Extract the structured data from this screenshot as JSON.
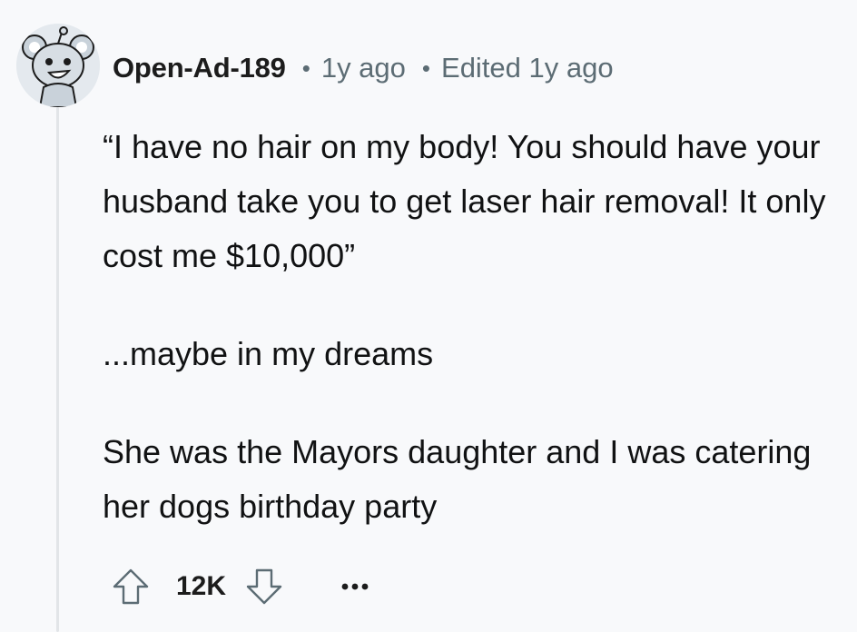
{
  "comment": {
    "author": "Open-Ad-189",
    "separator": "•",
    "age": "1y ago",
    "edited": "Edited 1y ago",
    "paragraphs": [
      "“I have no hair on my body! You should have your husband take you to get laser hair removal! It only cost me $10,000”",
      "...maybe in my dreams",
      "She was the Mayors daughter and I was catering her dogs birthday party"
    ]
  },
  "actions": {
    "score": "12K",
    "upvote_icon": "arrow-up-outline-icon",
    "downvote_icon": "arrow-down-outline-icon",
    "more_icon": "ellipsis-icon"
  },
  "colors": {
    "background": "#f8f9fb",
    "text": "#111213",
    "meta": "#5c6c74",
    "thread_line": "#e2e5e8"
  }
}
